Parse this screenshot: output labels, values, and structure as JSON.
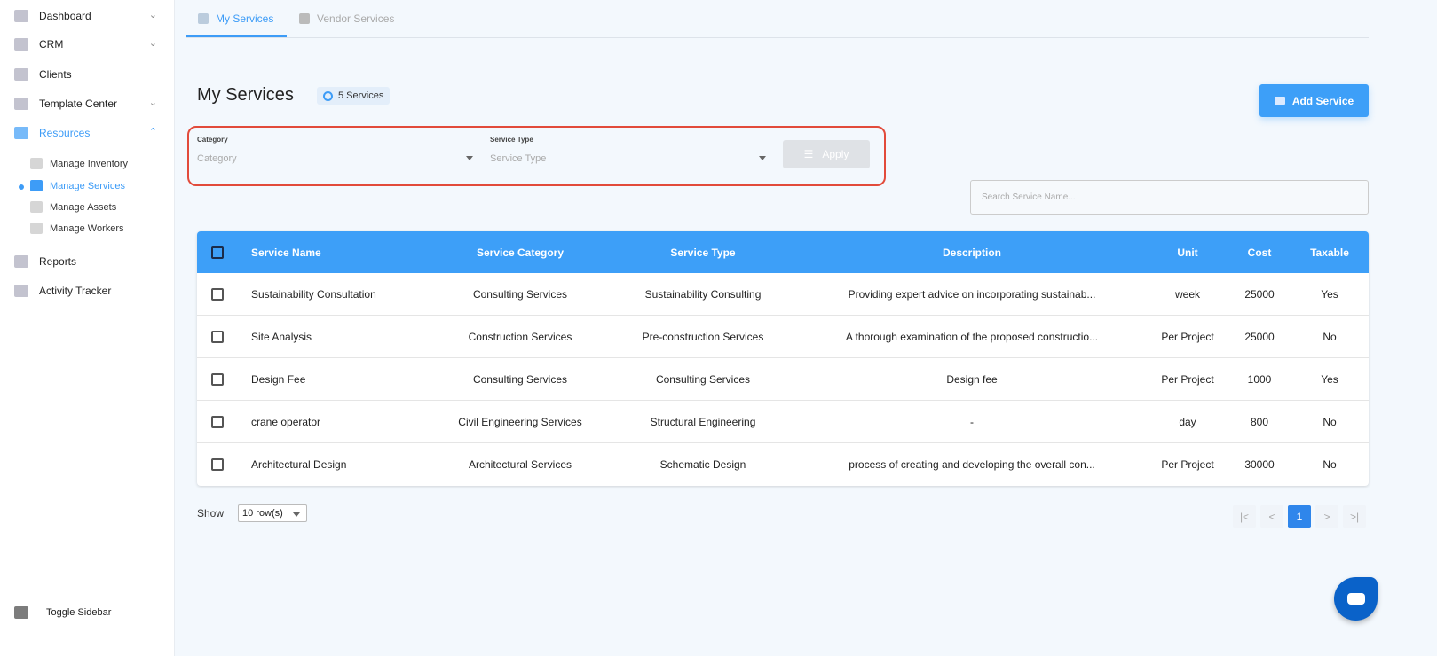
{
  "sidebar": {
    "items": [
      {
        "label": "Dashboard"
      },
      {
        "label": "CRM"
      },
      {
        "label": "Clients"
      },
      {
        "label": "Template Center"
      },
      {
        "label": "Resources"
      },
      {
        "label": "Reports"
      },
      {
        "label": "Activity Tracker"
      }
    ],
    "sub_items": [
      {
        "label": "Manage Inventory"
      },
      {
        "label": "Manage Services"
      },
      {
        "label": "Manage Assets"
      },
      {
        "label": "Manage Workers"
      }
    ],
    "toggle": "Toggle Sidebar"
  },
  "tabs": [
    {
      "label": "My Services"
    },
    {
      "label": "Vendor Services"
    }
  ],
  "page": {
    "title": "My Services",
    "badge": "5 Services",
    "add_button": "Add Service"
  },
  "filters": {
    "category_label": "Category",
    "category_placeholder": "Category",
    "type_label": "Service Type",
    "type_placeholder": "Service Type",
    "apply": "Apply"
  },
  "search": {
    "placeholder": "Search Service Name..."
  },
  "table": {
    "headers": [
      "Service Name",
      "Service Category",
      "Service Type",
      "Description",
      "Unit",
      "Cost",
      "Taxable"
    ],
    "rows": [
      [
        "Sustainability Consultation",
        "Consulting Services",
        "Sustainability Consulting",
        "Providing expert advice on incorporating sustainab...",
        "week",
        "25000",
        "Yes"
      ],
      [
        "Site Analysis",
        "Construction Services",
        "Pre-construction Services",
        "A thorough examination of the proposed constructio...",
        "Per Project",
        "25000",
        "No"
      ],
      [
        "Design Fee",
        "Consulting Services",
        "Consulting Services",
        "Design fee",
        "Per Project",
        "1000",
        "Yes"
      ],
      [
        "crane operator",
        "Civil Engineering Services",
        "Structural Engineering",
        "-",
        "day",
        "800",
        "No"
      ],
      [
        "Architectural Design",
        "Architectural Services",
        "Schematic Design",
        "process of creating and developing the overall con...",
        "Per Project",
        "30000",
        "No"
      ]
    ]
  },
  "pagination": {
    "show": "Show",
    "rows_per_page": "10 row(s)",
    "current_page": "1",
    "first": "|<",
    "prev": "<",
    "next": ">",
    "last": ">|"
  },
  "colors": {
    "accent": "#3d9ff8",
    "highlight": "#e24b3b"
  }
}
